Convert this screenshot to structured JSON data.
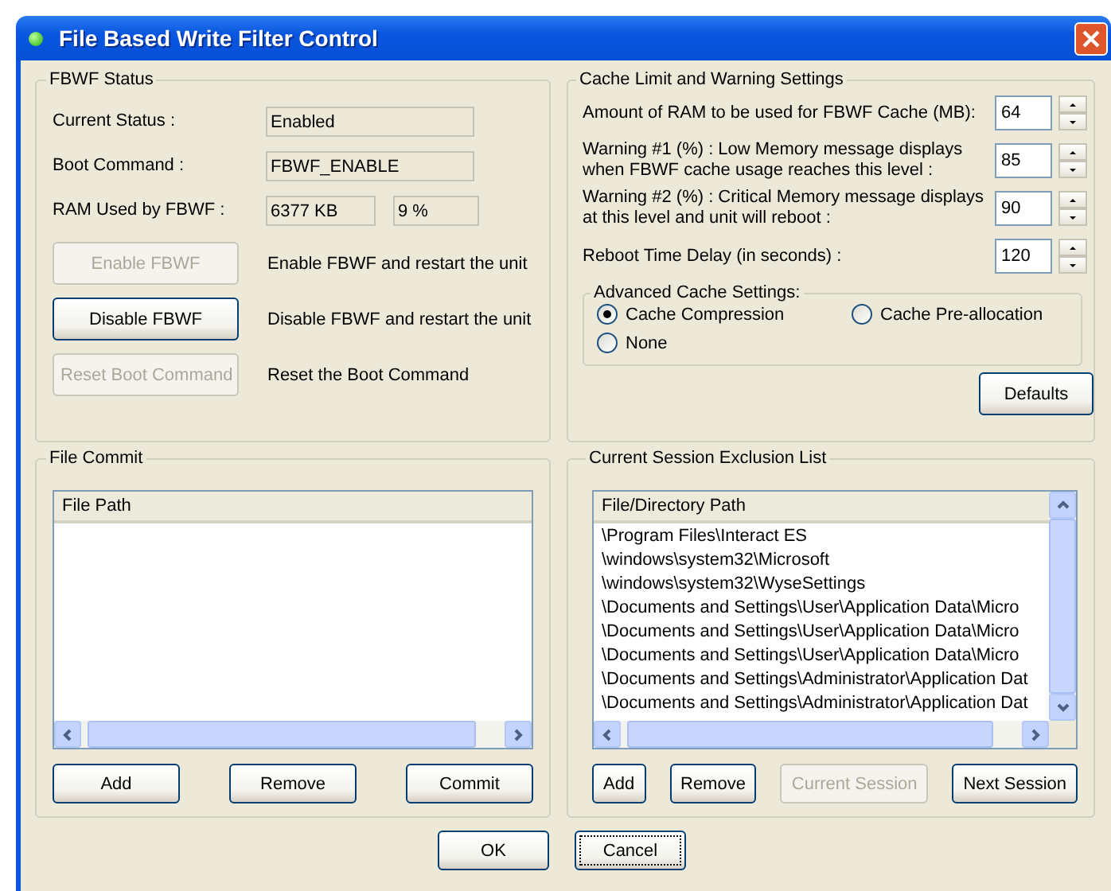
{
  "window": {
    "title": "File Based Write Filter Control"
  },
  "fbwf_status": {
    "title": "FBWF Status",
    "fields": [
      {
        "label": "Current Status :",
        "values": [
          "Enabled"
        ]
      },
      {
        "label": "Boot Command :",
        "values": [
          "FBWF_ENABLE"
        ]
      },
      {
        "label": "RAM Used by FBWF :",
        "values": [
          "6377 KB",
          "9 %"
        ]
      }
    ],
    "actions": [
      {
        "button": "Enable FBWF",
        "disabled": true,
        "description": "Enable FBWF and restart the unit"
      },
      {
        "button": "Disable FBWF",
        "disabled": false,
        "description": "Disable FBWF and restart the unit"
      },
      {
        "button": "Reset Boot Command",
        "disabled": true,
        "description": "Reset the Boot Command"
      }
    ]
  },
  "cache_settings": {
    "title": "Cache Limit and Warning Settings",
    "settings": [
      {
        "label": "Amount of RAM to be used for FBWF Cache (MB):",
        "value": "64"
      },
      {
        "label": "Warning #1 (%) : Low Memory message displays when FBWF cache usage reaches this level :",
        "value": "85"
      },
      {
        "label": "Warning #2 (%) : Critical Memory message displays at this level and unit will reboot :",
        "value": "90"
      },
      {
        "label": "Reboot Time Delay (in seconds) :",
        "value": "120"
      }
    ],
    "advanced": {
      "title": "Advanced Cache Settings:",
      "options": [
        {
          "label": "Cache Compression",
          "selected": true
        },
        {
          "label": "Cache Pre-allocation",
          "selected": false
        },
        {
          "label": "None",
          "selected": false
        }
      ]
    },
    "defaults_button": "Defaults"
  },
  "file_commit": {
    "title": "File Commit",
    "column": "File Path",
    "buttons": [
      {
        "label": "Add",
        "disabled": false
      },
      {
        "label": "Remove",
        "disabled": false
      },
      {
        "label": "Commit",
        "disabled": false
      }
    ]
  },
  "exclusion_list": {
    "title": "Current Session Exclusion List",
    "column": "File/Directory Path",
    "rows": [
      "\\Program Files\\Interact ES",
      "\\windows\\system32\\Microsoft",
      "\\windows\\system32\\WyseSettings",
      "\\Documents and Settings\\User\\Application Data\\Micro",
      "\\Documents and Settings\\User\\Application Data\\Micro",
      "\\Documents and Settings\\User\\Application Data\\Micro",
      "\\Documents and Settings\\Administrator\\Application Dat",
      "\\Documents and Settings\\Administrator\\Application Dat"
    ],
    "buttons": [
      {
        "label": "Add",
        "disabled": false
      },
      {
        "label": "Remove",
        "disabled": false
      },
      {
        "label": "Current Session",
        "disabled": true
      },
      {
        "label": "Next Session",
        "disabled": false
      }
    ]
  },
  "dialog_buttons": [
    {
      "label": "OK",
      "focused": false
    },
    {
      "label": "Cancel",
      "focused": true
    }
  ]
}
